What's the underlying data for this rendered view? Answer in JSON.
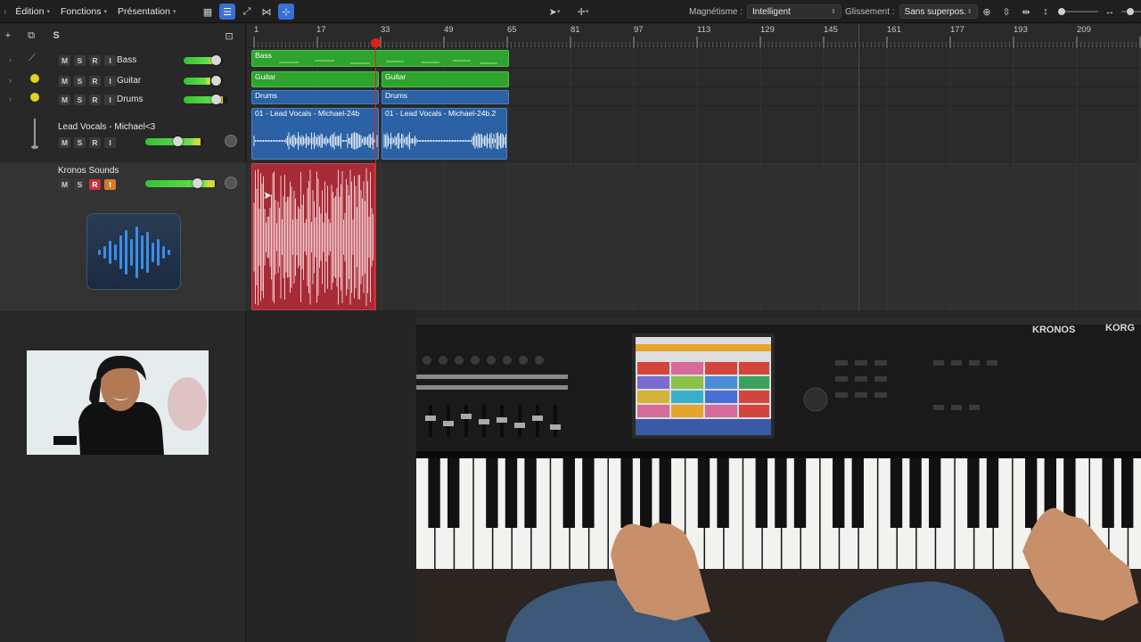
{
  "toolbar": {
    "edit_menu": "Édition",
    "functions_menu": "Fonctions",
    "view_menu": "Présentation",
    "snap_label": "Magnétisme :",
    "snap_value": "Intelligent",
    "drag_label": "Glissement :",
    "drag_value": "Sans superpos."
  },
  "ruler": {
    "marks": [
      "1",
      "17",
      "33",
      "49",
      "65",
      "81",
      "97",
      "113",
      "129",
      "145",
      "161",
      "177",
      "193",
      "209"
    ]
  },
  "tracks": [
    {
      "name": "Bass",
      "icon": "bass-guitar-icon"
    },
    {
      "name": "Guitar",
      "icon": "guitar-icon"
    },
    {
      "name": "Drums",
      "icon": "drums-icon"
    },
    {
      "name": "Lead Vocals - Michael<3",
      "icon": "microphone-icon"
    },
    {
      "name": "Kronos Sounds",
      "icon": "audio-waveform-icon"
    }
  ],
  "buttons": {
    "mute": "M",
    "solo": "S",
    "record": "R",
    "input": "I"
  },
  "regions": {
    "bass": "Bass",
    "guitar_1": "Guitar",
    "guitar_2": "Guitar",
    "drums_1": "Drums",
    "drums_2": "Drums",
    "vocals_1": "01 - Lead Vocals - Michael-24b",
    "vocals_2": "01 - Lead Vocals - Michael-24b.2"
  },
  "keyboard": {
    "model": "KRONOS",
    "brand": "KORG"
  },
  "colors": {
    "accent": "#3b6fd6",
    "region_green": "#2ea42e",
    "region_blue": "#2b62a6",
    "region_red": "#a72b36",
    "playhead": "#e02020"
  }
}
